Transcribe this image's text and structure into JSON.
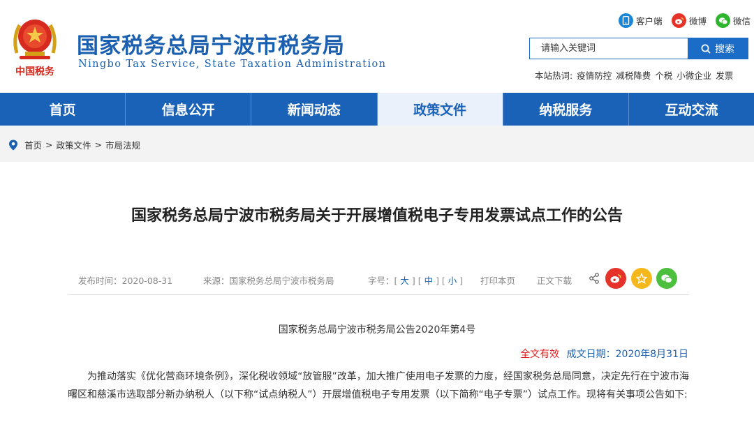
{
  "header": {
    "title": "国家税务总局宁波市税务局",
    "subtitle": "Ningbo Tax Service, State Taxation Administration",
    "emblem_text": "中国税务",
    "social": {
      "client": "客户端",
      "weibo": "微博",
      "wechat": "微信"
    },
    "search": {
      "placeholder": "请输入关键词",
      "button": "搜索"
    },
    "hot": {
      "label": "本站热词:",
      "words": [
        "疫情防控",
        "减税降费",
        "个税",
        "小微企业",
        "发票"
      ]
    }
  },
  "nav": {
    "items": [
      "首页",
      "信息公开",
      "新闻动态",
      "政策文件",
      "纳税服务",
      "互动交流"
    ],
    "active": "政策文件"
  },
  "breadcrumb": [
    "首页",
    "政策文件",
    "市局法规"
  ],
  "article": {
    "title": "国家税务总局宁波市税务局关于开展增值税电子专用发票试点工作的公告",
    "meta": {
      "time": "发布时间：2020-08-31",
      "source": "来源：国家税务总局宁波市税务局",
      "font_label": "字号：",
      "font_large": "大",
      "font_medium": "中",
      "font_small": "小",
      "print": "打印本页",
      "download": "正文下载"
    },
    "doc_number": "国家税务总局宁波市税务局公告2020年第4号",
    "validity": "全文有效",
    "date": "成文日期：2020年8月31日",
    "body": "为推动落实《优化营商环境条例》，深化税收领域“放管服”改革，加大推广使用电子发票的力度，经国家税务总局同意，决定先行在宁波市海曙区和慈溪市选取部分新办纳税人（以下称“试点纳税人”）开展增值税电子专用发票（以下简称“电子专票”）试点工作。现将有关事项公告如下:"
  },
  "colors": {
    "brand_blue": "#1a62b8",
    "alert_red": "#e02020"
  }
}
